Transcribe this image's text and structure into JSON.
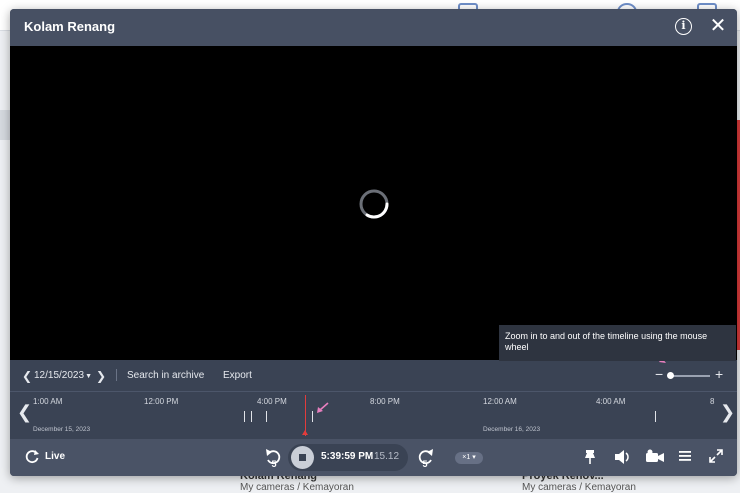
{
  "modal": {
    "title": "Kolam Renang"
  },
  "tooltip": {
    "text": "Zoom in to and out of the timeline using the mouse wheel"
  },
  "controls": {
    "date": "12/15/2023",
    "search_label": "Search in archive",
    "export_label": "Export",
    "zoom_minus": "−",
    "zoom_plus": "+",
    "zoom_level": 0.0
  },
  "timeline": {
    "ticks": [
      "1:00 AM",
      "12:00 PM",
      "4:00 PM",
      "8:00 PM",
      "12:00 AM",
      "4:00 AM",
      "8"
    ],
    "days": [
      "December 15, 2023",
      "December 16, 2023"
    ]
  },
  "bottom": {
    "live_label": "Live",
    "rewind_seconds": "5",
    "forward_seconds": "5",
    "time": "5:39:59 PM",
    "fps": "15.12",
    "speed": "×1"
  },
  "background": {
    "card1_title": "Kolam Renang",
    "card1_path": "My cameras / Kemayoran",
    "card2_title": "Proyek Renov...",
    "card2_path": "My cameras / Kemayoran"
  },
  "colors": {
    "modal_bg": "#3a4354",
    "header_bg": "#475063",
    "playhead": "#e23c3c",
    "accent_bg": "#6f8fc9"
  }
}
